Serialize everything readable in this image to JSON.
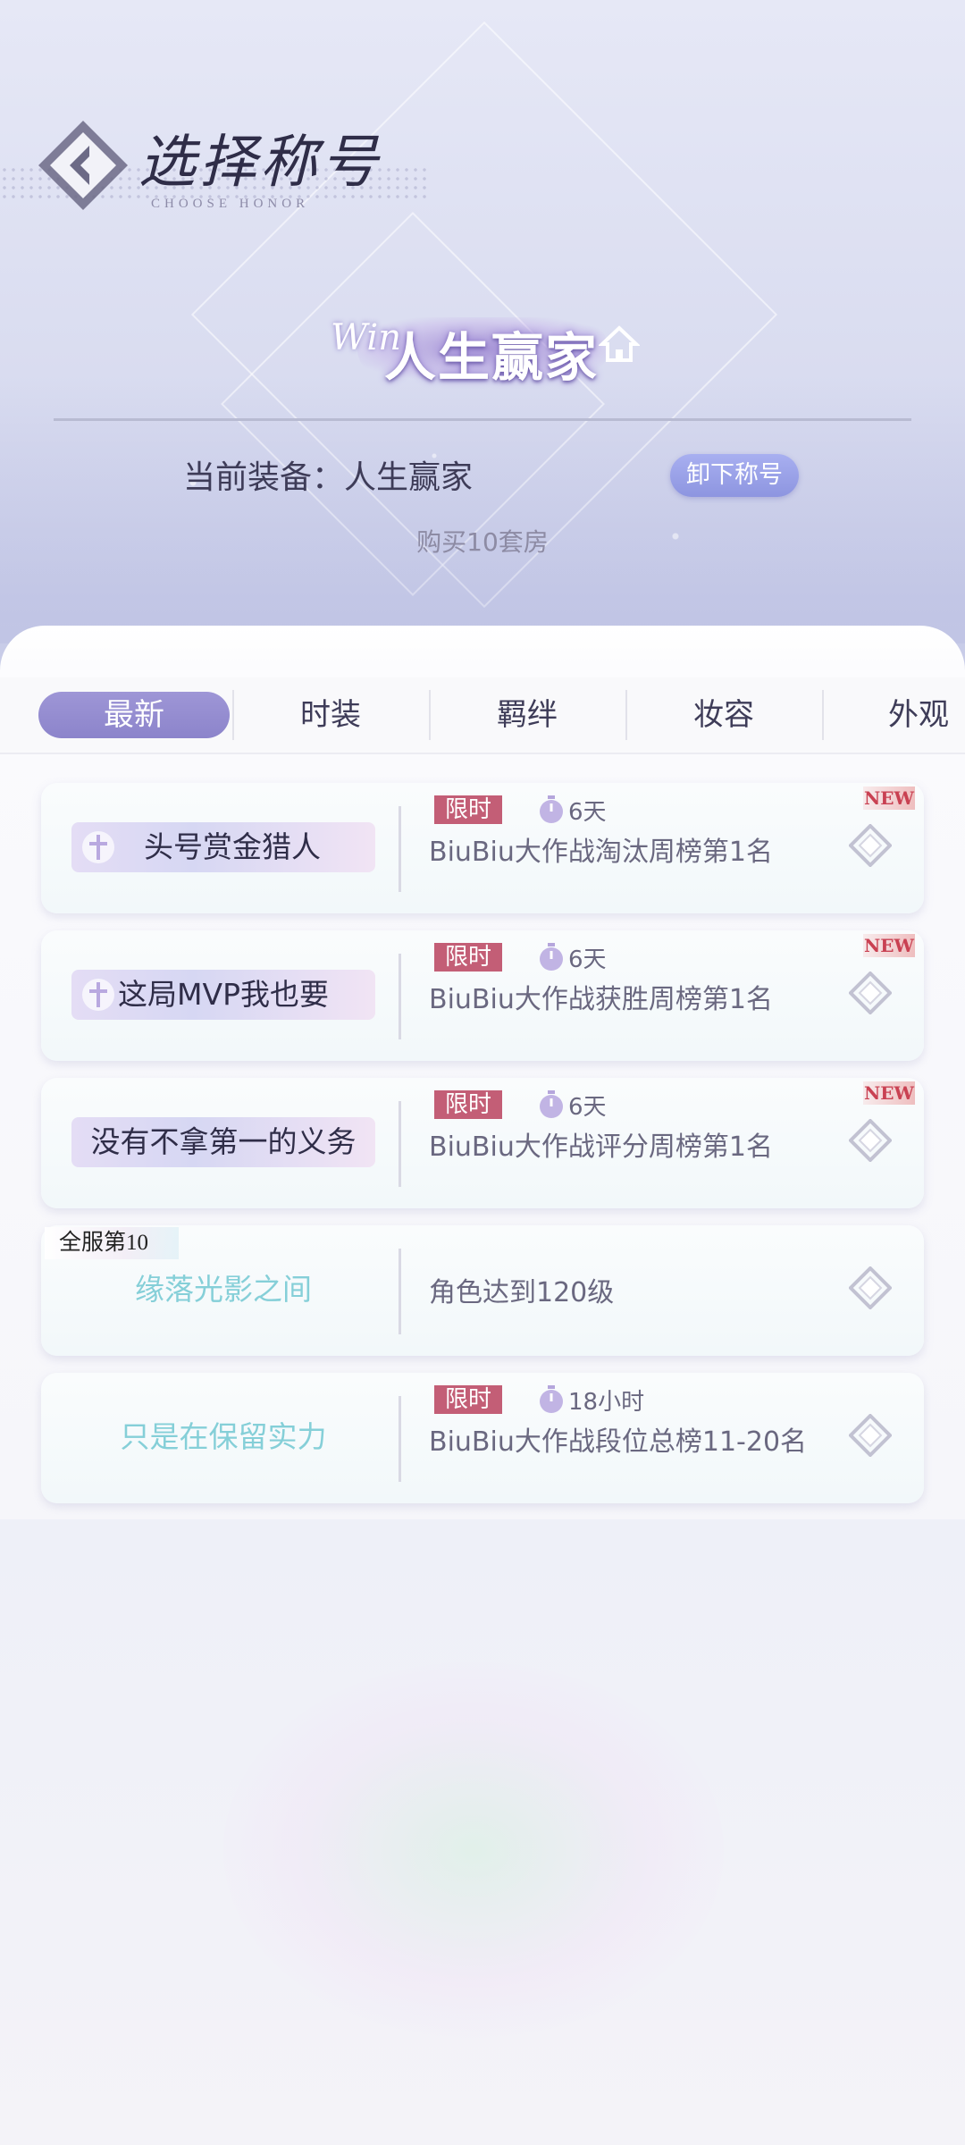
{
  "header": {
    "title": "选择称号",
    "subtitle": "CHOOSE HONOR"
  },
  "current": {
    "badge_prefix": "Win",
    "badge_name": "人生赢家",
    "equipped_label": "当前装备：人生赢家",
    "unequip_label": "卸下称号",
    "condition": "购买10套房"
  },
  "tabs": [
    {
      "label": "最新",
      "active": true
    },
    {
      "label": "时装",
      "active": false
    },
    {
      "label": "羁绊",
      "active": false
    },
    {
      "label": "妆容",
      "active": false
    },
    {
      "label": "外观",
      "active": false
    }
  ],
  "honors": [
    {
      "name": "头号赏金猎人",
      "limited_tag": "限时",
      "time_left": "6天",
      "condition": "BiuBiu大作战淘汰周榜第1名",
      "new_label": "NEW"
    },
    {
      "name": "这局MVP我也要",
      "limited_tag": "限时",
      "time_left": "6天",
      "condition": "BiuBiu大作战获胜周榜第1名",
      "new_label": "NEW"
    },
    {
      "name": "没有不拿第一的义务",
      "limited_tag": "限时",
      "time_left": "6天",
      "condition": "BiuBiu大作战评分周榜第1名",
      "new_label": "NEW"
    },
    {
      "name": "缘落光影之间",
      "rank_badge": "全服第10",
      "condition": "角色达到120级"
    },
    {
      "name": "只是在保留实力",
      "limited_tag": "限时",
      "time_left": "18小时",
      "condition": "BiuBiu大作战段位总榜11-20名"
    }
  ],
  "colors": {
    "accent": "#8c84cb",
    "limited_tag": "#c35e76",
    "plain_honor_text": "#85cfd8",
    "new_badge": "#c94152"
  },
  "icons": {
    "back": "back-arrow-diamond-icon",
    "timer": "stopwatch-icon",
    "select": "diamond-select-icon",
    "house": "house-icon"
  }
}
